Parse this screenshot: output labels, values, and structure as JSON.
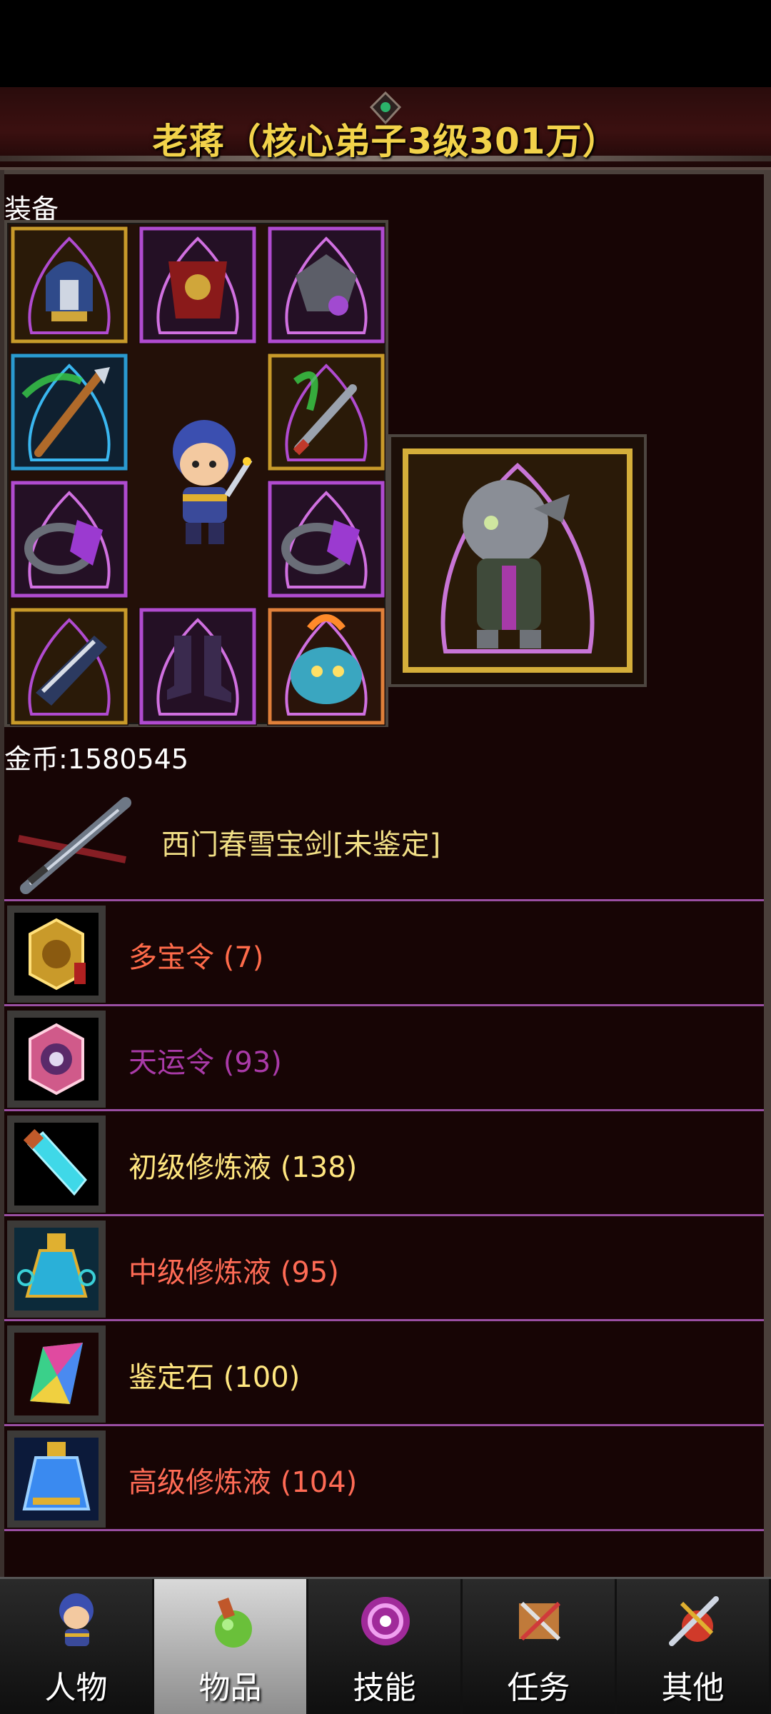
{
  "header": {
    "title": "老蒋（核心弟子3级301万）"
  },
  "equipment": {
    "section_label": "装备",
    "slots": [
      {
        "name": "helmet",
        "icon": "helmet-icon",
        "rarity_color": "#c89a2a"
      },
      {
        "name": "armor",
        "icon": "armor-icon",
        "rarity_color": "#b04bd0"
      },
      {
        "name": "shoulder",
        "icon": "shoulder-icon",
        "rarity_color": "#b04bd0"
      },
      {
        "name": "weapon",
        "icon": "spear-icon",
        "rarity_color": "#2a9ad0"
      },
      {
        "name": "dagger",
        "icon": "dagger-icon",
        "rarity_color": "#c89a2a"
      },
      {
        "name": "ring-left",
        "icon": "ring-icon",
        "rarity_color": "#b04bd0"
      },
      {
        "name": "ring-right",
        "icon": "ring-icon",
        "rarity_color": "#b04bd0"
      },
      {
        "name": "bracer",
        "icon": "bracer-icon",
        "rarity_color": "#c89a2a"
      },
      {
        "name": "boots",
        "icon": "boots-icon",
        "rarity_color": "#b04bd0"
      },
      {
        "name": "mount",
        "icon": "beast-icon",
        "rarity_color": "#e0803a"
      }
    ],
    "pet_icon": "robot-pet-icon"
  },
  "gold": {
    "label": "金币:1580545"
  },
  "featured_item": {
    "name": "西门春雪宝剑[未鉴定]",
    "icon": "sword-icon"
  },
  "items": [
    {
      "label": "多宝令 (7)",
      "icon": "gold-token-icon",
      "color": "#ff6b4a"
    },
    {
      "label": "天运令 (93)",
      "icon": "fortune-token-icon",
      "color": "#a93aa8"
    },
    {
      "label": "初级修炼液 (138)",
      "icon": "cyan-vial-icon",
      "color": "#ffe680"
    },
    {
      "label": "中级修炼液 (95)",
      "icon": "potion-flask-icon",
      "color": "#ff6b55"
    },
    {
      "label": "鉴定石 (100)",
      "icon": "rainbow-gem-icon",
      "color": "#ffe680"
    },
    {
      "label": "高级修炼液 (104)",
      "icon": "blue-bottle-icon",
      "color": "#ff6b55"
    }
  ],
  "tabs": [
    {
      "label": "人物",
      "icon": "character-icon",
      "active": false
    },
    {
      "label": "物品",
      "icon": "item-bag-icon",
      "active": true
    },
    {
      "label": "技能",
      "icon": "skill-orb-icon",
      "active": false
    },
    {
      "label": "任务",
      "icon": "quest-scroll-icon",
      "active": false
    },
    {
      "label": "其他",
      "icon": "other-swords-icon",
      "active": false
    }
  ]
}
